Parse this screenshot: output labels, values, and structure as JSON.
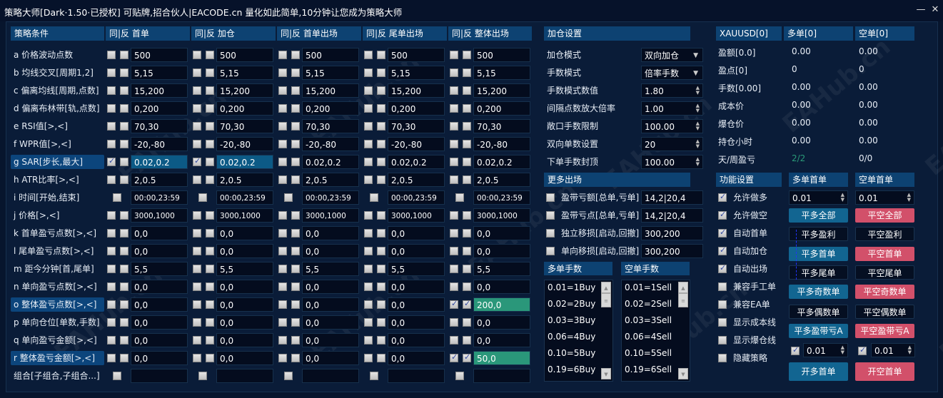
{
  "window": {
    "title": "策略大师[Dark·1.50·已授权]  可贴牌,招合伙人|EACODE.cn  量化如此简单,10分钟让您成为策略大师",
    "minimize": "—",
    "close": "✕"
  },
  "strategy": {
    "headers": [
      "策略条件",
      "同|反 首单",
      "同|反 加仓",
      "同|反 首单出场",
      "同|反 尾单出场",
      "同|反 整体出场"
    ],
    "rows": [
      {
        "label": "a 价格波动点数",
        "values": [
          "500",
          "500",
          "500",
          "500",
          "500"
        ]
      },
      {
        "label": "b 均线交叉[周期1,2]",
        "values": [
          "5,15",
          "5,15",
          "5,15",
          "5,15",
          "5,15"
        ]
      },
      {
        "label": "c 偏离均线[周期,点数]",
        "values": [
          "15,200",
          "15,200",
          "15,200",
          "15,200",
          "15,200"
        ]
      },
      {
        "label": "d 偏离布林带[轨,点数]",
        "values": [
          "0,200",
          "0,200",
          "0,200",
          "0,200",
          "0,200"
        ]
      },
      {
        "label": "e RSI值[>,<]",
        "values": [
          "70,30",
          "70,30",
          "70,30",
          "70,30",
          "70,30"
        ]
      },
      {
        "label": "f WPR值[>,<]",
        "values": [
          "-20,-80",
          "-20,-80",
          "-20,-80",
          "-20,-80",
          "-20,-80"
        ]
      },
      {
        "label": "g SAR[步长,最大]",
        "values": [
          "0.02,0.2",
          "0.02,0.2",
          "0.02,0.2",
          "0.02,0.2",
          "0.02,0.2"
        ],
        "highlight": true,
        "checked": [
          [
            true,
            false
          ],
          [
            true,
            false
          ],
          [
            false,
            false
          ],
          [
            false,
            false
          ],
          [
            false,
            false
          ]
        ],
        "active": [
          0,
          1
        ]
      },
      {
        "label": "h ATR比率[>,<]",
        "values": [
          "2,0.5",
          "2,0.5",
          "2,0.5",
          "2,0.5",
          "2,0.5"
        ]
      },
      {
        "label": "i 时间[开始,结束]",
        "values": [
          "00:00,23:59",
          "00:00,23:59",
          "00:00,23:59",
          "00:00,23:59",
          "00:00,23:59"
        ],
        "single": true,
        "small": true
      },
      {
        "label": "j 价格[>,<]",
        "values": [
          "3000,1000",
          "3000,1000",
          "3000,1000",
          "3000,1000",
          "3000,1000"
        ],
        "small": true
      },
      {
        "label": "k 首单盈亏点数[>,<]",
        "values": [
          "0,0",
          "0,0",
          "0,0",
          "0,0",
          "0,0"
        ]
      },
      {
        "label": "l 尾单盈亏点数[>,<]",
        "values": [
          "0,0",
          "0,0",
          "0,0",
          "0,0",
          "0,0"
        ]
      },
      {
        "label": "m 距今分钟[首,尾单]",
        "values": [
          "5,5",
          "5,5",
          "5,5",
          "5,5",
          "5,5"
        ]
      },
      {
        "label": "n 单向盈亏点数[>,<]",
        "values": [
          "0,0",
          "0,0",
          "0,0",
          "0,0",
          "0,0"
        ]
      },
      {
        "label": "o 整体盈亏点数[>,<]",
        "values": [
          "0,0",
          "0,0",
          "0,0",
          "0,0",
          "200,0"
        ],
        "highlight": true,
        "checked": [
          [
            false,
            false
          ],
          [
            false,
            false
          ],
          [
            false,
            false
          ],
          [
            false,
            false
          ],
          [
            true,
            true
          ]
        ],
        "green": [
          4
        ]
      },
      {
        "label": "p 单向仓位[单数,手数]",
        "values": [
          "0,0",
          "0,0",
          "0,0",
          "0,0",
          "0,0"
        ]
      },
      {
        "label": "q 单向盈亏金额[>,<]",
        "values": [
          "0,0",
          "0,0",
          "0,0",
          "0,0",
          "0,0"
        ]
      },
      {
        "label": "r 整体盈亏金额[>,<]",
        "values": [
          "0,0",
          "0,0",
          "0,0",
          "0,0",
          "50,0"
        ],
        "highlight": true,
        "checked": [
          [
            false,
            false
          ],
          [
            false,
            false
          ],
          [
            false,
            false
          ],
          [
            false,
            false
          ],
          [
            true,
            true
          ]
        ],
        "green": [
          4
        ]
      },
      {
        "label": "组合[子组合,子组合...]",
        "values": [
          "",
          "",
          "",
          "",
          ""
        ],
        "single": true
      }
    ]
  },
  "add_settings": {
    "header": "加仓设置",
    "rows": [
      {
        "label": "加仓模式",
        "value": "双向加仓",
        "type": "dropdown"
      },
      {
        "label": "手数模式",
        "value": "倍率手数",
        "type": "dropdown"
      },
      {
        "label": "手数模式数值",
        "value": "1.80",
        "type": "spin"
      },
      {
        "label": "间隔点数放大倍率",
        "value": "1.00",
        "type": "spin"
      },
      {
        "label": "敞口手数限制",
        "value": "100.00",
        "type": "spin"
      },
      {
        "label": "双向单数设置",
        "value": "20",
        "type": "spin"
      },
      {
        "label": "下单手数封顶",
        "value": "100.00",
        "type": "spin"
      }
    ]
  },
  "more_exit": {
    "header": "更多出场",
    "rows": [
      {
        "label": "盈带亏额[总单,亏单]",
        "value": "14,2|20,4",
        "checked": false
      },
      {
        "label": "盈带亏点[总单,亏单]",
        "value": "14,2|20,4",
        "checked": false
      },
      {
        "label": "独立移损[启动,回撤]",
        "value": "300,200",
        "checked": false
      },
      {
        "label": "单向移损[启动,回撤]",
        "value": "300,200",
        "checked": false
      }
    ]
  },
  "lot_lists": {
    "buy_header": "多单手数",
    "sell_header": "空单手数",
    "buy": [
      "0.01=1Buy",
      "0.02=2Buy",
      "0.03=3Buy",
      "0.06=4Buy",
      "0.10=5Buy",
      "0.19=6Buy"
    ],
    "sell": [
      "0.01=1Sell",
      "0.02=2Sell",
      "0.03=3Sell",
      "0.06=4Sell",
      "0.10=5Sell",
      "0.19=6Sell"
    ]
  },
  "stats": {
    "headers": [
      "XAUUSD[0]",
      "多单[0]",
      "空单[0]"
    ],
    "rows": [
      {
        "label": "盈额[0.0]",
        "buy": "0.00",
        "sell": "0.00"
      },
      {
        "label": "盈点[0]",
        "buy": "0",
        "sell": "0"
      },
      {
        "label": "手数[0.00]",
        "buy": "0.00",
        "sell": "0.00"
      },
      {
        "label": "成本价",
        "buy": "0.00",
        "sell": "0.00"
      },
      {
        "label": "爆仓价",
        "buy": "0.00",
        "sell": "0.00"
      },
      {
        "label": "持仓小时",
        "buy": "0.00",
        "sell": "0.00"
      },
      {
        "label": "天/周盈亏",
        "buy": "2/2",
        "sell": "0/0"
      }
    ],
    "green_color": "#2a9a78"
  },
  "functions": {
    "headers": [
      "功能设置",
      "多单首单",
      "空单首单"
    ],
    "options": [
      {
        "label": "允许做多",
        "checked": true
      },
      {
        "label": "允许做空",
        "checked": true
      },
      {
        "label": "自动首单",
        "checked": true
      },
      {
        "label": "自动加仓",
        "checked": true
      },
      {
        "label": "自动出场",
        "checked": true
      },
      {
        "label": "兼容手工单",
        "checked": false
      },
      {
        "label": "兼容EA单",
        "checked": false
      },
      {
        "label": "显示成本线",
        "checked": false
      },
      {
        "label": "显示爆仓线",
        "checked": false
      },
      {
        "label": "隐藏策略",
        "checked": false
      }
    ],
    "buy_lot": "0.01",
    "sell_lot": "0.01",
    "buttons": [
      [
        "平多全部",
        "blue",
        "平空全部",
        "red"
      ],
      [
        "平多盈利",
        "dark",
        "平空盈利",
        "dark"
      ],
      [
        "平多首单",
        "blue",
        "平空首单",
        "red"
      ],
      [
        "平多尾单",
        "dark",
        "平空尾单",
        "dark"
      ],
      [
        "平多奇数单",
        "blue",
        "平空奇数单",
        "red"
      ],
      [
        "平多偶数单",
        "dark",
        "平空偶数单",
        "dark"
      ],
      [
        "平多盈带亏A",
        "blue",
        "平空盈带亏A",
        "red"
      ]
    ],
    "buy_open_lot": "0.01",
    "sell_open_lot": "0.01",
    "open_buy": "开多首单",
    "open_sell": "开空首单",
    "colors": {
      "blue": "#126591",
      "red": "#d2506a"
    }
  },
  "watermark": "EAHub.cn"
}
